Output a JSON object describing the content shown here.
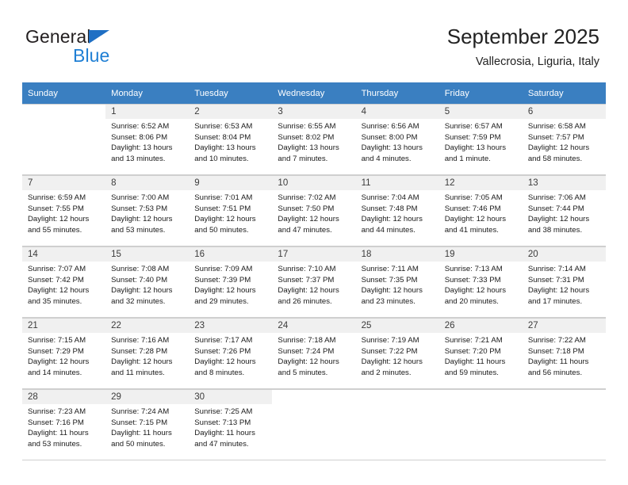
{
  "logo": {
    "text_top": "General",
    "text_bottom": "Blue",
    "triangle_color": "#1f6fc4",
    "blue_color": "#1f7fd4"
  },
  "header": {
    "title": "September 2025",
    "subtitle": "Vallecrosia, Liguria, Italy"
  },
  "colors": {
    "header_row_bg": "#3a7fc1",
    "daynum_bg": "#f0f0f0",
    "grid_line": "#cfcfcf"
  },
  "weekdays": [
    "Sunday",
    "Monday",
    "Tuesday",
    "Wednesday",
    "Thursday",
    "Friday",
    "Saturday"
  ],
  "labels": {
    "sunrise_prefix": "Sunrise:",
    "sunset_prefix": "Sunset:",
    "daylight_prefix": "Daylight:"
  },
  "weeks": [
    [
      {
        "empty": true
      },
      {
        "day": "1",
        "line1": "Sunrise: 6:52 AM",
        "line2": "Sunset: 8:06 PM",
        "line3": "Daylight: 13 hours",
        "line4": "and 13 minutes."
      },
      {
        "day": "2",
        "line1": "Sunrise: 6:53 AM",
        "line2": "Sunset: 8:04 PM",
        "line3": "Daylight: 13 hours",
        "line4": "and 10 minutes."
      },
      {
        "day": "3",
        "line1": "Sunrise: 6:55 AM",
        "line2": "Sunset: 8:02 PM",
        "line3": "Daylight: 13 hours",
        "line4": "and 7 minutes."
      },
      {
        "day": "4",
        "line1": "Sunrise: 6:56 AM",
        "line2": "Sunset: 8:00 PM",
        "line3": "Daylight: 13 hours",
        "line4": "and 4 minutes."
      },
      {
        "day": "5",
        "line1": "Sunrise: 6:57 AM",
        "line2": "Sunset: 7:59 PM",
        "line3": "Daylight: 13 hours",
        "line4": "and 1 minute."
      },
      {
        "day": "6",
        "line1": "Sunrise: 6:58 AM",
        "line2": "Sunset: 7:57 PM",
        "line3": "Daylight: 12 hours",
        "line4": "and 58 minutes."
      }
    ],
    [
      {
        "day": "7",
        "line1": "Sunrise: 6:59 AM",
        "line2": "Sunset: 7:55 PM",
        "line3": "Daylight: 12 hours",
        "line4": "and 55 minutes."
      },
      {
        "day": "8",
        "line1": "Sunrise: 7:00 AM",
        "line2": "Sunset: 7:53 PM",
        "line3": "Daylight: 12 hours",
        "line4": "and 53 minutes."
      },
      {
        "day": "9",
        "line1": "Sunrise: 7:01 AM",
        "line2": "Sunset: 7:51 PM",
        "line3": "Daylight: 12 hours",
        "line4": "and 50 minutes."
      },
      {
        "day": "10",
        "line1": "Sunrise: 7:02 AM",
        "line2": "Sunset: 7:50 PM",
        "line3": "Daylight: 12 hours",
        "line4": "and 47 minutes."
      },
      {
        "day": "11",
        "line1": "Sunrise: 7:04 AM",
        "line2": "Sunset: 7:48 PM",
        "line3": "Daylight: 12 hours",
        "line4": "and 44 minutes."
      },
      {
        "day": "12",
        "line1": "Sunrise: 7:05 AM",
        "line2": "Sunset: 7:46 PM",
        "line3": "Daylight: 12 hours",
        "line4": "and 41 minutes."
      },
      {
        "day": "13",
        "line1": "Sunrise: 7:06 AM",
        "line2": "Sunset: 7:44 PM",
        "line3": "Daylight: 12 hours",
        "line4": "and 38 minutes."
      }
    ],
    [
      {
        "day": "14",
        "line1": "Sunrise: 7:07 AM",
        "line2": "Sunset: 7:42 PM",
        "line3": "Daylight: 12 hours",
        "line4": "and 35 minutes."
      },
      {
        "day": "15",
        "line1": "Sunrise: 7:08 AM",
        "line2": "Sunset: 7:40 PM",
        "line3": "Daylight: 12 hours",
        "line4": "and 32 minutes."
      },
      {
        "day": "16",
        "line1": "Sunrise: 7:09 AM",
        "line2": "Sunset: 7:39 PM",
        "line3": "Daylight: 12 hours",
        "line4": "and 29 minutes."
      },
      {
        "day": "17",
        "line1": "Sunrise: 7:10 AM",
        "line2": "Sunset: 7:37 PM",
        "line3": "Daylight: 12 hours",
        "line4": "and 26 minutes."
      },
      {
        "day": "18",
        "line1": "Sunrise: 7:11 AM",
        "line2": "Sunset: 7:35 PM",
        "line3": "Daylight: 12 hours",
        "line4": "and 23 minutes."
      },
      {
        "day": "19",
        "line1": "Sunrise: 7:13 AM",
        "line2": "Sunset: 7:33 PM",
        "line3": "Daylight: 12 hours",
        "line4": "and 20 minutes."
      },
      {
        "day": "20",
        "line1": "Sunrise: 7:14 AM",
        "line2": "Sunset: 7:31 PM",
        "line3": "Daylight: 12 hours",
        "line4": "and 17 minutes."
      }
    ],
    [
      {
        "day": "21",
        "line1": "Sunrise: 7:15 AM",
        "line2": "Sunset: 7:29 PM",
        "line3": "Daylight: 12 hours",
        "line4": "and 14 minutes."
      },
      {
        "day": "22",
        "line1": "Sunrise: 7:16 AM",
        "line2": "Sunset: 7:28 PM",
        "line3": "Daylight: 12 hours",
        "line4": "and 11 minutes."
      },
      {
        "day": "23",
        "line1": "Sunrise: 7:17 AM",
        "line2": "Sunset: 7:26 PM",
        "line3": "Daylight: 12 hours",
        "line4": "and 8 minutes."
      },
      {
        "day": "24",
        "line1": "Sunrise: 7:18 AM",
        "line2": "Sunset: 7:24 PM",
        "line3": "Daylight: 12 hours",
        "line4": "and 5 minutes."
      },
      {
        "day": "25",
        "line1": "Sunrise: 7:19 AM",
        "line2": "Sunset: 7:22 PM",
        "line3": "Daylight: 12 hours",
        "line4": "and 2 minutes."
      },
      {
        "day": "26",
        "line1": "Sunrise: 7:21 AM",
        "line2": "Sunset: 7:20 PM",
        "line3": "Daylight: 11 hours",
        "line4": "and 59 minutes."
      },
      {
        "day": "27",
        "line1": "Sunrise: 7:22 AM",
        "line2": "Sunset: 7:18 PM",
        "line3": "Daylight: 11 hours",
        "line4": "and 56 minutes."
      }
    ],
    [
      {
        "day": "28",
        "line1": "Sunrise: 7:23 AM",
        "line2": "Sunset: 7:16 PM",
        "line3": "Daylight: 11 hours",
        "line4": "and 53 minutes."
      },
      {
        "day": "29",
        "line1": "Sunrise: 7:24 AM",
        "line2": "Sunset: 7:15 PM",
        "line3": "Daylight: 11 hours",
        "line4": "and 50 minutes."
      },
      {
        "day": "30",
        "line1": "Sunrise: 7:25 AM",
        "line2": "Sunset: 7:13 PM",
        "line3": "Daylight: 11 hours",
        "line4": "and 47 minutes."
      },
      {
        "empty": true
      },
      {
        "empty": true
      },
      {
        "empty": true
      },
      {
        "empty": true
      }
    ]
  ]
}
